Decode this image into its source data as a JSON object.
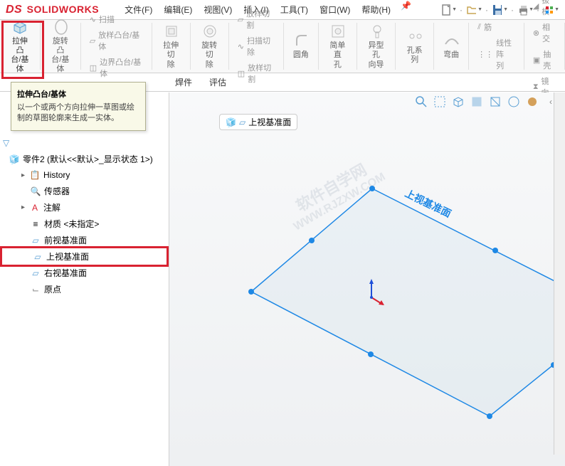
{
  "app": {
    "name": "SOLIDWORKS",
    "prefix": "DS"
  },
  "menus": {
    "file": "文件(F)",
    "edit": "编辑(E)",
    "view": "视图(V)",
    "insert": "插入(I)",
    "tools": "工具(T)",
    "window": "窗口(W)",
    "help": "帮助(H)"
  },
  "ribbon": {
    "extrude_boss": "拉伸凸\n台/基体",
    "revolve_boss": "旋转凸\n台/基体",
    "sweep": "扫描",
    "loft": "放样凸台/基体",
    "boundary": "边界凸台/基体",
    "extrude_cut": "拉伸切\n除",
    "revolve_cut": "旋转切\n除",
    "loft_cut": "放样切割",
    "sweep_cut": "扫描切除",
    "boundary_cut": "放样切割",
    "fillet": "圆角",
    "simple_hole": "简单直\n孔",
    "special_hole": "异型孔\n向导",
    "hole_series": "孔系列",
    "bend": "弯曲",
    "rib": "筋",
    "linear_pattern": "线性阵\n列",
    "draft": "拔模",
    "intersect": "相交",
    "shell": "抽壳",
    "mirror": "镜向"
  },
  "tabs": {
    "weldment": "焊件",
    "evaluate": "评估"
  },
  "tooltip": {
    "title": "拉伸凸台/基体",
    "body": "以一个或两个方向拉伸一草图或绘制的草图轮廓来生成一实体。"
  },
  "tree": {
    "root": "零件2  (默认<<默认>_显示状态 1>)",
    "history": "History",
    "sensors": "传感器",
    "annotations": "注解",
    "material": "材质 <未指定>",
    "front_plane": "前视基准面",
    "top_plane": "上视基准面",
    "right_plane": "右视基准面",
    "origin": "原点"
  },
  "breadcrumb": {
    "label": "上视基准面"
  },
  "watermark": {
    "line1": "软件自学网",
    "line2": "WWW.RJZXW.COM"
  },
  "colors": {
    "red": "#d92231",
    "blue": "#1976d2",
    "light_blue": "#5a9fd4"
  }
}
